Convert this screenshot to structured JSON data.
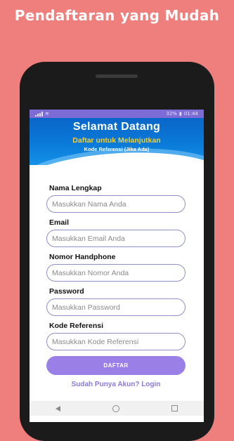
{
  "promo": {
    "title": "Pendaftaran yang Mudah"
  },
  "statusbar": {
    "battery": "32%",
    "time": "01:44"
  },
  "header": {
    "welcome": "Selamat Datang",
    "subtitle": "Daftar untuk Melanjutkan",
    "referral_note": "Kode Referensi (Jika Ada)"
  },
  "form": {
    "fields": [
      {
        "label": "Nama Lengkap",
        "placeholder": "Masukkan Nama Anda",
        "value": ""
      },
      {
        "label": "Email",
        "placeholder": "Masukkan Email Anda",
        "value": ""
      },
      {
        "label": "Nomor Handphone",
        "placeholder": "Masukkan Nomor Anda",
        "value": ""
      },
      {
        "label": "Password",
        "placeholder": "Masukkan Password",
        "value": ""
      },
      {
        "label": "Kode Referensi",
        "placeholder": "Masukkan Kode Referensi",
        "value": ""
      }
    ],
    "submit_label": "DAFTAR",
    "login_link": "Sudah Punya Akun? Login"
  },
  "colors": {
    "background": "#ef7f7c",
    "header_blue": "#0a66c8",
    "subtitle_yellow": "#f6cf2a",
    "accent_purple": "#9a80e6"
  },
  "icons": [
    "signal-icon",
    "wifi-icon",
    "battery-icon",
    "nav-back-icon",
    "nav-home-icon",
    "nav-recent-icon"
  ]
}
